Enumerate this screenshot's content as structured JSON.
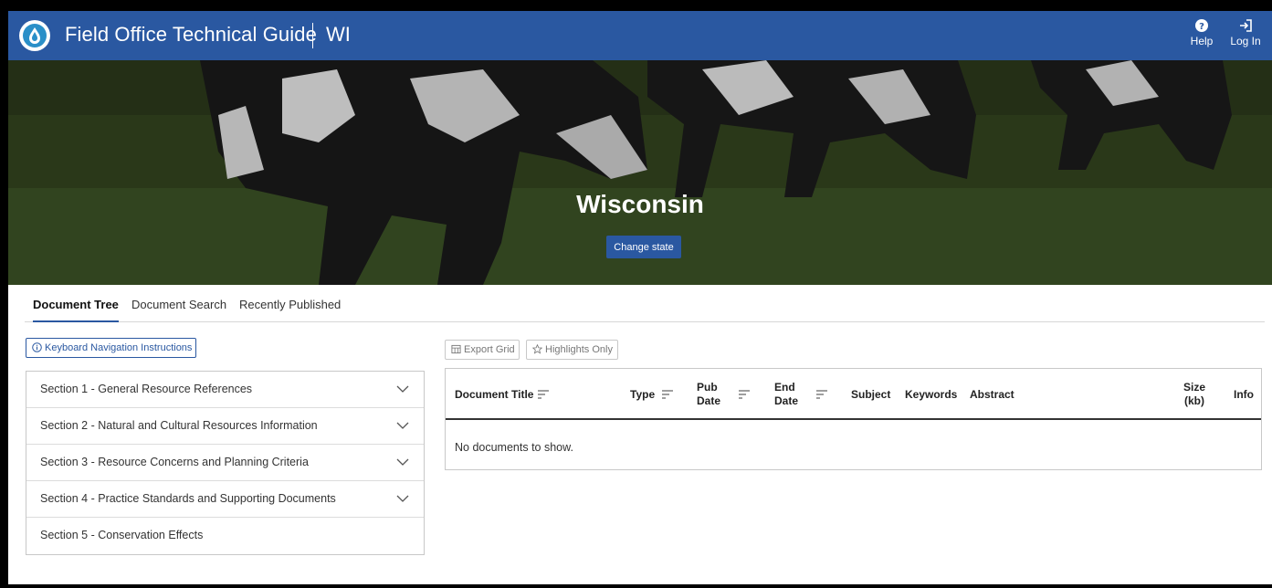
{
  "header": {
    "app_title": "Field Office Technical Guide",
    "state_code": "WI",
    "help_label": "Help",
    "login_label": "Log In",
    "brand_color": "#2a58a1"
  },
  "hero": {
    "title": "Wisconsin",
    "change_state_label": "Change state"
  },
  "tabs": [
    {
      "label": "Document Tree",
      "active": true
    },
    {
      "label": "Document Search",
      "active": false
    },
    {
      "label": "Recently Published",
      "active": false
    }
  ],
  "keyboard_nav_label": "Keyboard Navigation Instructions",
  "sections": [
    {
      "label": "Section 1 - General Resource References",
      "expandable": true
    },
    {
      "label": "Section 2 - Natural and Cultural Resources Information",
      "expandable": true
    },
    {
      "label": "Section 3 - Resource Concerns and Planning Criteria",
      "expandable": true
    },
    {
      "label": "Section 4 - Practice Standards and Supporting Documents",
      "expandable": true
    },
    {
      "label": "Section 5 - Conservation Effects",
      "expandable": false
    }
  ],
  "grid": {
    "export_label": "Export Grid",
    "highlights_label": "Highlights Only",
    "columns": {
      "title": "Document Title",
      "type": "Type",
      "pub_date_1": "Pub",
      "pub_date_2": "Date",
      "end_date_1": "End",
      "end_date_2": "Date",
      "subject": "Subject",
      "keywords": "Keywords",
      "abstract": "Abstract",
      "size_1": "Size",
      "size_2": "(kb)",
      "info": "Info"
    },
    "empty_message": "No documents to show."
  }
}
